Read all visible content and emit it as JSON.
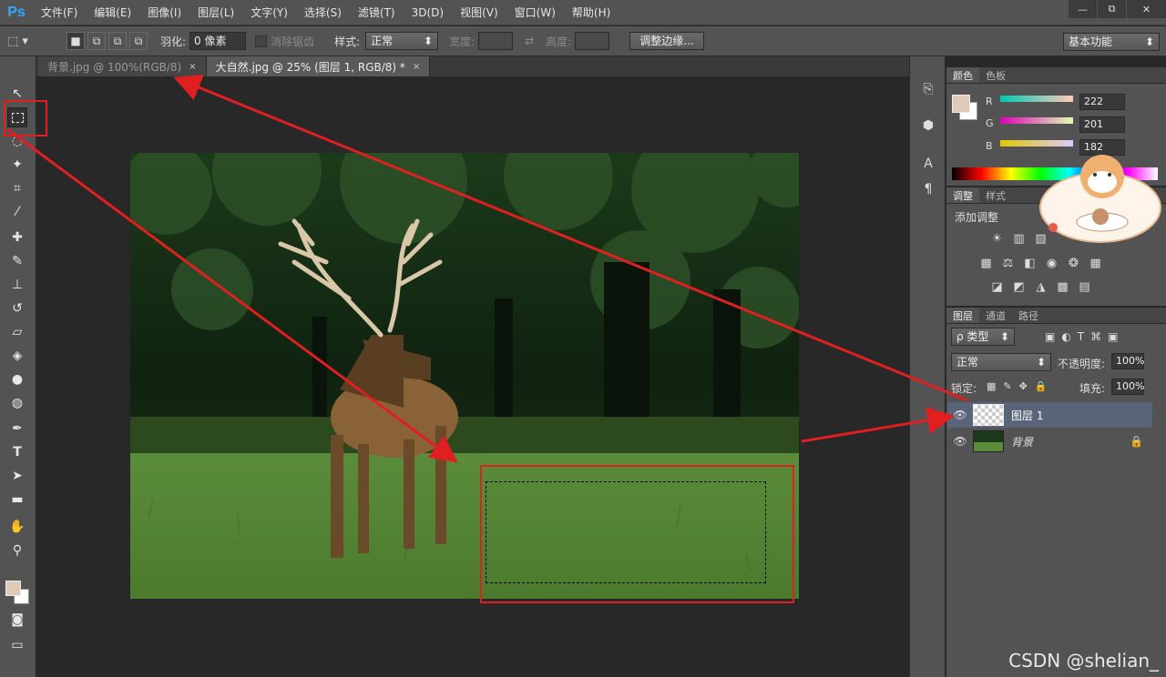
{
  "app": {
    "logo": "Ps"
  },
  "menu": [
    "文件(F)",
    "编辑(E)",
    "图像(I)",
    "图层(L)",
    "文字(Y)",
    "选择(S)",
    "滤镜(T)",
    "3D(D)",
    "视图(V)",
    "窗口(W)",
    "帮助(H)"
  ],
  "window_controls": {
    "minimize": "—",
    "restore": "⧉",
    "close": "✕"
  },
  "options": {
    "feather_label": "羽化:",
    "feather_value": "0 像素",
    "antialias_label": "消除锯齿",
    "style_label": "样式:",
    "style_value": "正常",
    "width_label": "宽度:",
    "height_label": "高度:",
    "refine_button": "调整边缘...",
    "workspace": "基本功能",
    "swap_icon": "⇄"
  },
  "tabs": [
    {
      "label": "背景.jpg @ 100%(RGB/8)",
      "close": "×"
    },
    {
      "label": "大自然.jpg @ 25% (图层 1, RGB/8) *",
      "close": "×"
    }
  ],
  "color_panel": {
    "tabs": [
      "颜色",
      "色板"
    ],
    "r_label": "R",
    "g_label": "G",
    "b_label": "B",
    "r": "222",
    "g": "201",
    "b": "182",
    "fg_color": "#decab6"
  },
  "adjust_panel": {
    "tabs": [
      "调整",
      "样式"
    ],
    "title": "添加调整"
  },
  "layers_panel": {
    "tabs": [
      "图层",
      "通道",
      "路径"
    ],
    "filter": "ρ 类型",
    "blend": "正常",
    "opacity_label": "不透明度:",
    "opacity": "100%",
    "lock_label": "锁定:",
    "fill_label": "填充:",
    "fill": "100%",
    "layers": [
      {
        "name": "图层 1",
        "selected": true
      },
      {
        "name": "背景",
        "locked": true
      }
    ]
  },
  "icons": {
    "visibility": "eye-icon",
    "lock": "lock-icon",
    "move": "move-icon",
    "marquee": "marquee-icon"
  },
  "watermark": "CSDN @shelian_",
  "colors": {
    "ui": "#535353",
    "canvas": "#282828",
    "accent": "#31a8ff",
    "selected_layer": "#596478",
    "annotation": "#e02020"
  }
}
